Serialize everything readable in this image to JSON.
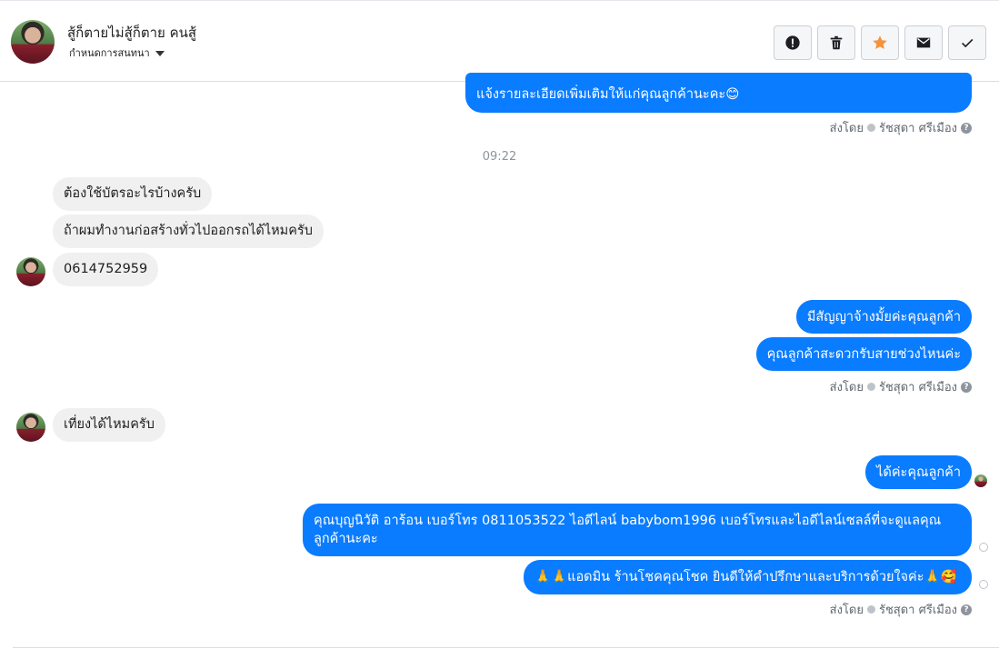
{
  "header": {
    "contact_name": "สู้ก็ตายไม่สู้ก็ตาย คนสู้",
    "subtitle": "กำหนดการสนทนา",
    "buttons": [
      "alert-icon",
      "trash-icon",
      "star-icon",
      "mail-icon",
      "check-icon"
    ],
    "star_color": "#f7923b"
  },
  "messages": {
    "top_out": "แจ้งรายละเอียดเพิ่มเติมให้แก่คุณลูกค้านะคะ😊",
    "sent_by_prefix": "ส่งโดย",
    "sent_by_name": "รัชสุดา ศรีเมือง",
    "time": "09:22",
    "in_1": "ต้องใช้บัตรอะไรบ้างครับ",
    "in_2": "ถ้าผมทำงานก่อสร้างทั่วไปออกรถได้ไหมครับ",
    "in_3": "0614752959",
    "out_1": "มีสัญญาจ้างมั้ยค่ะคุณลูกค้า",
    "out_2": "คุณลูกค้าสะดวกรับสายช่วงไหนค่ะ",
    "in_4": "เที่ยงได้ไหมครับ",
    "out_3": "ได้ค่ะคุณลูกค้า",
    "out_4": "คุณบุญนิวัติ  อาร้อน        เบอร์โทร 0811053522  ไอดีไลน์ babybom1996   เบอร์โทรและไอดีไลน์เซลล์ที่จะดูแลคุณลูกค้านะคะ",
    "out_5": "🙏🙏แอดมิน ร้านโชคคุณโชค ยินดีให้คำปรึกษาและบริการด้วยใจค่ะ🙏🥰",
    "outgoing_color": "#0a7cff",
    "incoming_color": "#f0f0f0"
  }
}
